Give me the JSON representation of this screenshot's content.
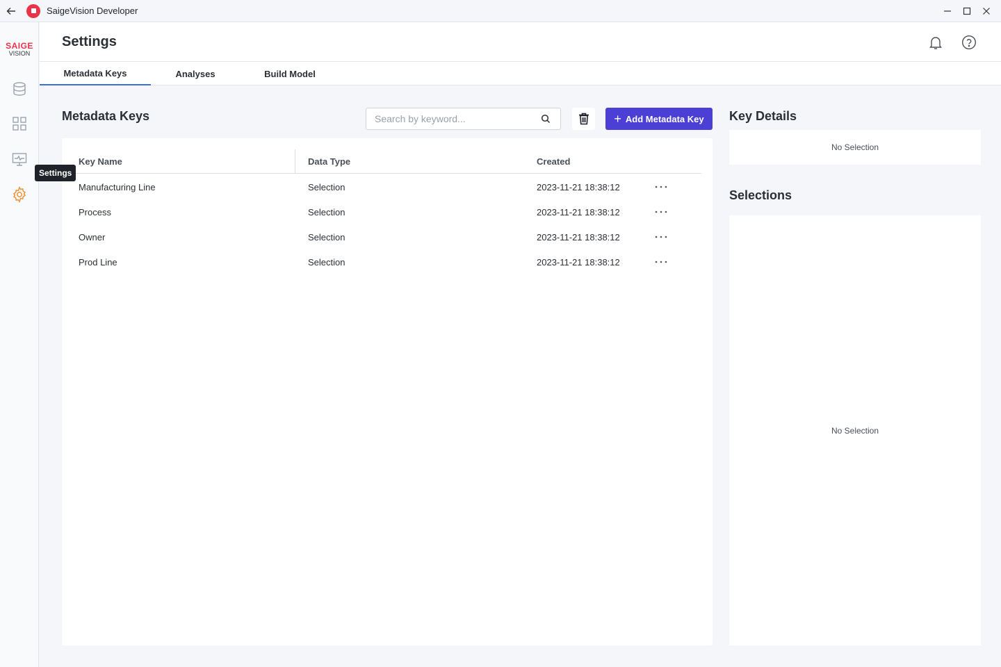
{
  "window": {
    "title": "SaigeVision Developer"
  },
  "logo": {
    "main": "SAIGE",
    "sub": "VISION"
  },
  "sidebar": {
    "items": [
      {
        "icon": "database-icon",
        "label": "Data"
      },
      {
        "icon": "grid-icon",
        "label": "Projects"
      },
      {
        "icon": "monitor-icon",
        "label": "Monitoring"
      },
      {
        "icon": "gear-icon",
        "label": "Settings",
        "active": true
      }
    ],
    "tooltip": "Settings"
  },
  "header": {
    "title": "Settings"
  },
  "tabs": [
    {
      "label": "Metadata Keys",
      "active": true
    },
    {
      "label": "Analyses",
      "active": false
    },
    {
      "label": "Build Model",
      "active": false
    }
  ],
  "metadata": {
    "title": "Metadata Keys",
    "search_placeholder": "Search by keyword...",
    "add_button": "Add Metadata Key",
    "columns": [
      "Key Name",
      "Data Type",
      "Created"
    ],
    "rows": [
      {
        "name": "Manufacturing Line",
        "type": "Selection",
        "created": "2023-11-21 18:38:12"
      },
      {
        "name": "Process",
        "type": "Selection",
        "created": "2023-11-21 18:38:12"
      },
      {
        "name": "Owner",
        "type": "Selection",
        "created": "2023-11-21 18:38:12"
      },
      {
        "name": "Prod Line",
        "type": "Selection",
        "created": "2023-11-21 18:38:12"
      }
    ]
  },
  "key_details": {
    "title": "Key Details",
    "empty": "No Selection"
  },
  "selections": {
    "title": "Selections",
    "empty": "No Selection"
  },
  "colors": {
    "accent": "#4b3fd6",
    "tab_indicator": "#3d6fd8",
    "brand": "#e8334a",
    "settings_icon": "#e8923a"
  }
}
